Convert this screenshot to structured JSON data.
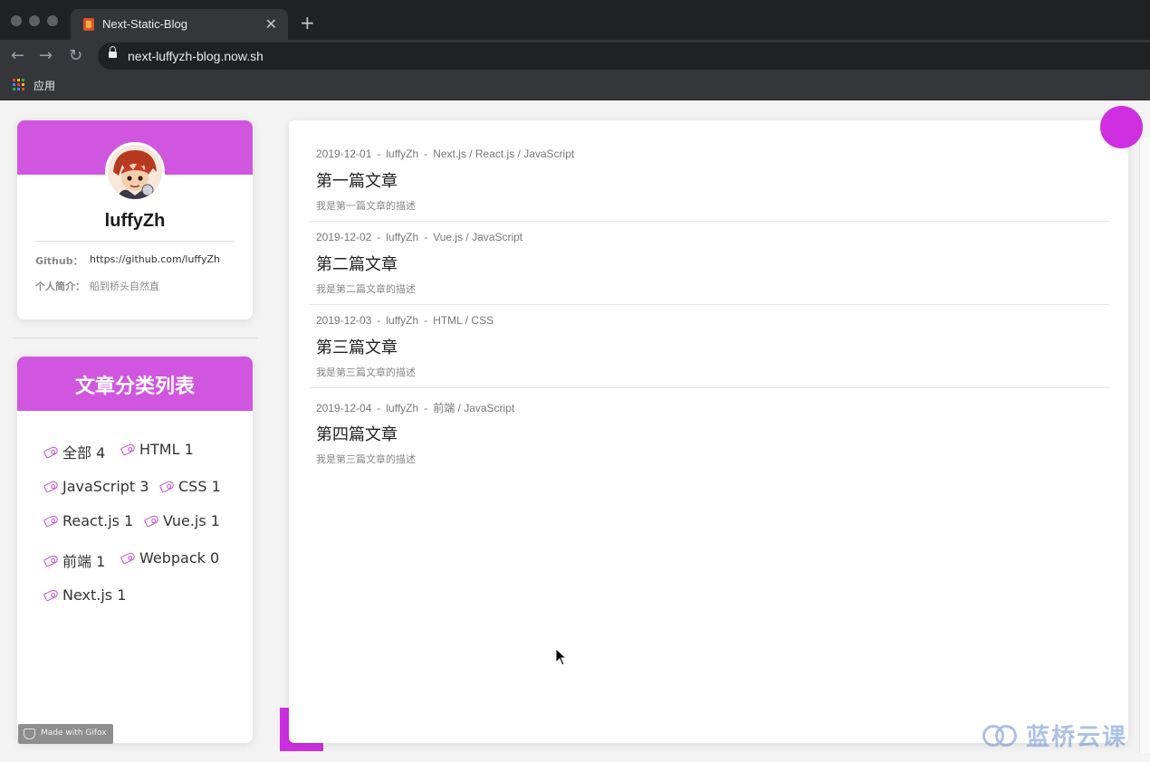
{
  "browser": {
    "tab_title": "Next-Static-Blog",
    "tab_close": "✕",
    "new_tab": "+",
    "url": "next-luffyzh-blog.now.sh",
    "bookmark_label": "应用"
  },
  "profile": {
    "name": "luffyZh",
    "github_key": "Github：",
    "github_value": "https://github.com/luffyZh",
    "bio_key": "个人简介：",
    "bio_value": "船到桥头自然直"
  },
  "categories": {
    "title": "文章分类列表",
    "tags": [
      {
        "label": "全部 4"
      },
      {
        "label": "HTML 1"
      },
      {
        "label": "JavaScript 3"
      },
      {
        "label": "CSS 1"
      },
      {
        "label": "React.js 1"
      },
      {
        "label": "Vue.js 1"
      },
      {
        "label": "前端 1"
      },
      {
        "label": "Webpack 0"
      },
      {
        "label": "Next.js 1"
      }
    ]
  },
  "articles": [
    {
      "date": "2019-12-01",
      "author": "luffyZh",
      "tags": "Next.js / React.js / JavaScript",
      "title": "第一篇文章",
      "desc": "我是第一篇文章的描述"
    },
    {
      "date": "2019-12-02",
      "author": "luffyZh",
      "tags": "Vue.js / JavaScript",
      "title": "第二篇文章",
      "desc": "我是第二篇文章的描述"
    },
    {
      "date": "2019-12-03",
      "author": "luffyZh",
      "tags": "HTML / CSS",
      "title": "第三篇文章",
      "desc": "我是第三篇文章的描述"
    },
    {
      "date": "2019-12-04",
      "author": "luffyZh",
      "tags": "前端 / JavaScript",
      "title": "第四篇文章",
      "desc": "我是第三篇文章的描述"
    }
  ],
  "overlay": {
    "gifox_label": "Made with Gifox",
    "watermark": "蓝桥云课"
  },
  "colors": {
    "accent": "#d056e0",
    "browser_dark": "#202124",
    "browser_mid": "#35363a"
  }
}
